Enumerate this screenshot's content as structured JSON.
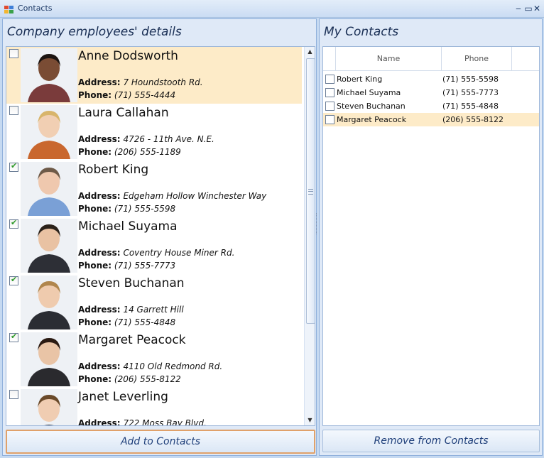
{
  "window": {
    "title": "Contacts"
  },
  "left_panel": {
    "header": "Company employees' details",
    "address_label": "Address:",
    "phone_label": "Phone:",
    "employees": [
      {
        "name": "Anne Dodsworth",
        "address": "7 Houndstooth Rd.",
        "phone": "(71) 555-4444",
        "checked": false,
        "selected": true
      },
      {
        "name": "Laura Callahan",
        "address": "4726 - 11th Ave. N.E.",
        "phone": "(206) 555-1189",
        "checked": false,
        "selected": false
      },
      {
        "name": "Robert King",
        "address": "Edgeham Hollow Winchester Way",
        "phone": "(71) 555-5598",
        "checked": true,
        "selected": false
      },
      {
        "name": "Michael Suyama",
        "address": "Coventry House Miner Rd.",
        "phone": "(71) 555-7773",
        "checked": true,
        "selected": false
      },
      {
        "name": "Steven Buchanan",
        "address": "14 Garrett Hill",
        "phone": "(71) 555-4848",
        "checked": true,
        "selected": false
      },
      {
        "name": "Margaret Peacock",
        "address": "4110 Old Redmond Rd.",
        "phone": "(206) 555-8122",
        "checked": true,
        "selected": false
      },
      {
        "name": "Janet Leverling",
        "address": "722 Moss Bay Blvd.",
        "phone": "",
        "checked": false,
        "selected": false
      }
    ],
    "add_button": "Add to Contacts"
  },
  "right_panel": {
    "header": "My Contacts",
    "columns": {
      "name": "Name",
      "phone": "Phone"
    },
    "contacts": [
      {
        "name": "Robert King",
        "phone": "(71) 555-5598",
        "selected": false
      },
      {
        "name": "Michael Suyama",
        "phone": "(71) 555-7773",
        "selected": false
      },
      {
        "name": "Steven Buchanan",
        "phone": "(71) 555-4848",
        "selected": false
      },
      {
        "name": "Margaret Peacock",
        "phone": "(206) 555-8122",
        "selected": true
      }
    ],
    "remove_button": "Remove from Contacts"
  },
  "colors": {
    "selection": "#fdebc8",
    "panel_bg": "#dfe9f7",
    "checkmark": "#2f9a2a",
    "button_focus_border": "#e0a16a"
  }
}
